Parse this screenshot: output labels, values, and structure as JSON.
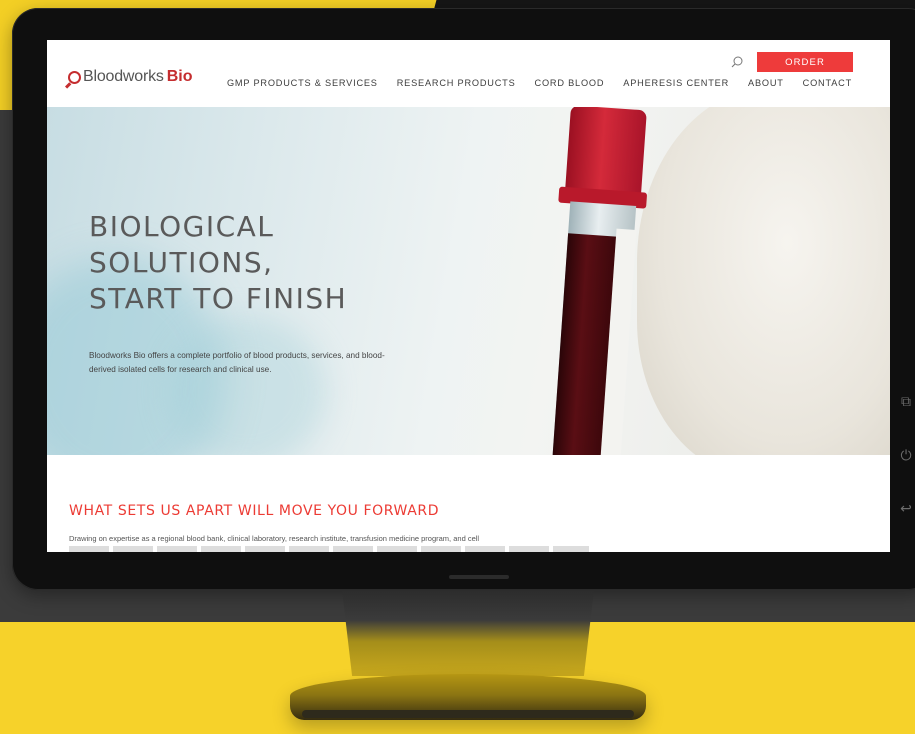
{
  "site": {
    "logo_part1": "Bloodworks",
    "logo_part2": "Bio",
    "order_label": "ORDER",
    "nav": [
      "GMP PRODUCTS & SERVICES",
      "RESEARCH PRODUCTS",
      "CORD BLOOD",
      "APHERESIS CENTER",
      "ABOUT",
      "CONTACT"
    ]
  },
  "hero": {
    "title_line1": "BIOLOGICAL",
    "title_line2": "SOLUTIONS,",
    "title_line3": "START TO FINISH",
    "description": "Bloodworks Bio offers a complete portfolio of blood products, services, and blood-derived isolated cells for research and clinical use."
  },
  "section": {
    "title": "WHAT SETS US APART WILL MOVE YOU FORWARD",
    "body": "Drawing on expertise as a regional blood bank, clinical laboratory, research institute, transfusion medicine program, and cell"
  },
  "icons": {
    "search": "search-icon",
    "side_buttons": [
      "window-icon",
      "power-icon",
      "back-icon"
    ]
  },
  "colors": {
    "accent_red": "#ee3b3b",
    "background_yellow": "#f6d22a"
  }
}
